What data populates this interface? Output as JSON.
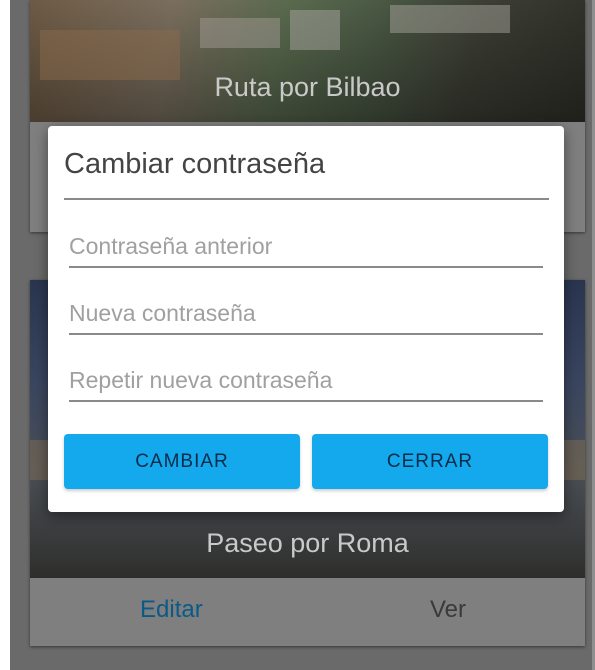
{
  "cards": [
    {
      "title": "Ruta por Bilbao"
    },
    {
      "title": "Paseo por Roma",
      "actions": {
        "edit": "Editar",
        "view": "Ver"
      }
    }
  ],
  "dialog": {
    "title": "Cambiar contraseña",
    "fields": {
      "old_password": {
        "placeholder": "Contraseña anterior",
        "value": ""
      },
      "new_password": {
        "placeholder": "Nueva contraseña",
        "value": ""
      },
      "repeat_password": {
        "placeholder": "Repetir nueva contraseña",
        "value": ""
      }
    },
    "buttons": {
      "change": "CAMBIAR",
      "close": "CERRAR"
    }
  },
  "colors": {
    "accent": "#14a8ec",
    "scrim": "#6a6a6a",
    "link": "#0b5a86"
  }
}
